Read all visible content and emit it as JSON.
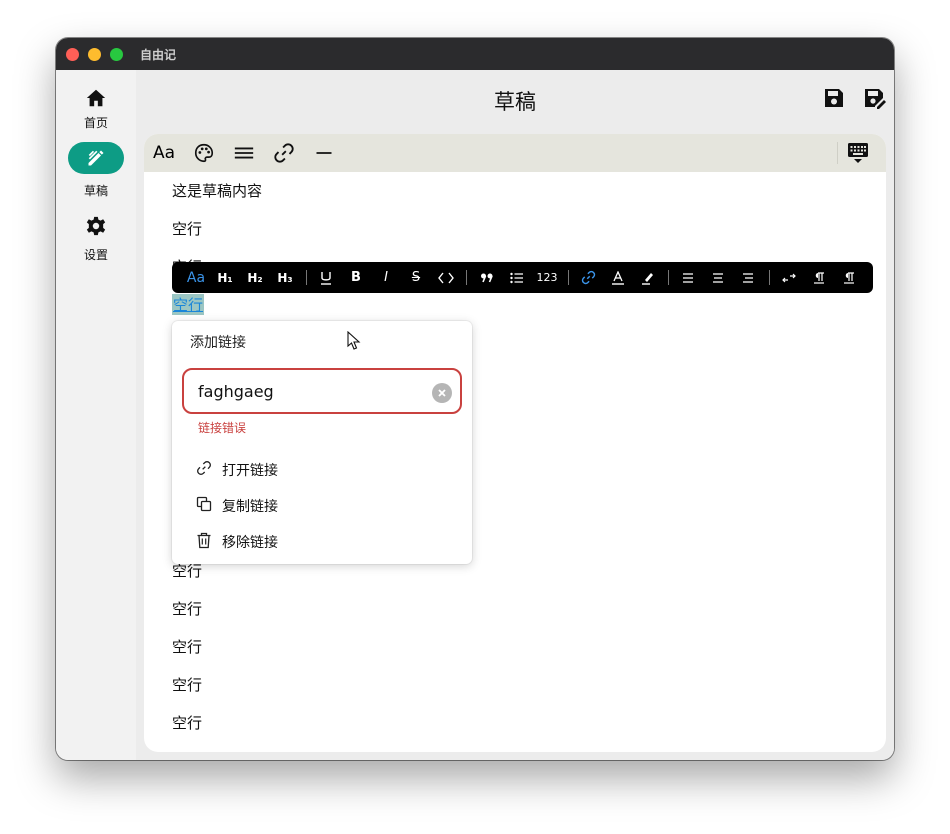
{
  "window": {
    "title": "自由记"
  },
  "sidebar": {
    "items": [
      {
        "label": "首页",
        "icon": "home-icon",
        "active": false
      },
      {
        "label": "草稿",
        "icon": "draft-edit-icon",
        "active": true
      },
      {
        "label": "设置",
        "icon": "gear-icon",
        "active": false
      }
    ]
  },
  "header": {
    "title": "草稿",
    "save_icon": "save-icon",
    "save_as_icon": "save-edit-icon"
  },
  "editor": {
    "toolbar_icons": [
      "text-style-icon",
      "palette-icon",
      "menu-lines-icon",
      "link-icon",
      "horizontal-rule-icon",
      "keyboard-hide-icon"
    ],
    "toolbar": {
      "text_style_label": "Aa"
    },
    "lines": [
      "这是草稿内容",
      "空行",
      "空行",
      "空行",
      "空行",
      "空行",
      "空行",
      "空行",
      "空行"
    ],
    "selected_line": "空行"
  },
  "format_bar": {
    "heading_aa": "Aa",
    "h1": "H₁",
    "h2": "H₂",
    "h3": "H₃",
    "bold": "B",
    "italic": "I",
    "strike": "S",
    "numbered": "123",
    "accent_color": "#3a93e8"
  },
  "link_popup": {
    "title": "添加链接",
    "input_value": "faghgaeg",
    "error": "链接错误",
    "actions": [
      {
        "label": "打开链接",
        "icon": "link-icon"
      },
      {
        "label": "复制链接",
        "icon": "copy-icon"
      },
      {
        "label": "移除链接",
        "icon": "trash-icon"
      }
    ],
    "error_color": "#c9413f"
  },
  "colors": {
    "accent": "#0d9c85",
    "toolbar_bg": "#e5e5dd"
  }
}
